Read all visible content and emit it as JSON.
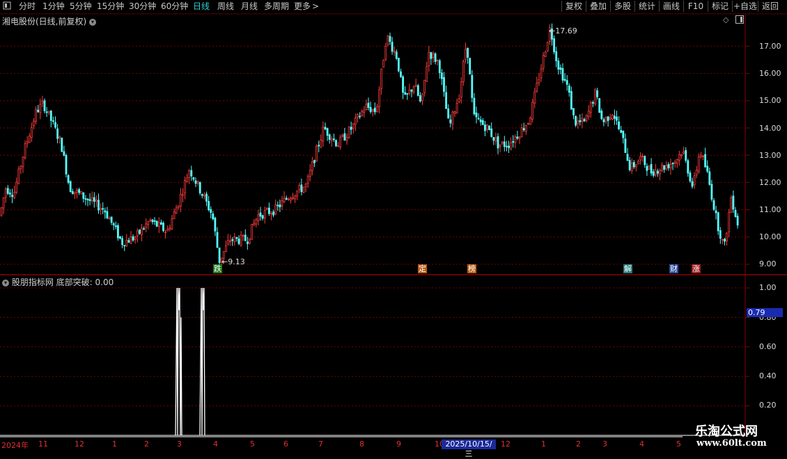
{
  "toolbar": {
    "periods": [
      "分时",
      "1分钟",
      "5分钟",
      "15分钟",
      "30分钟",
      "60分钟",
      "日线",
      "周线",
      "月线",
      "多周期",
      "更多"
    ],
    "active_period": "日线",
    "more_arrow": ">",
    "buttons": [
      "复权",
      "叠加",
      "多股",
      "统计",
      "画线",
      "F10",
      "标记",
      "+自选",
      "返回"
    ]
  },
  "chart_title": "湘电股份(日线,前复权)",
  "indicator_title": "股朋指标网  底部突破: 0.00",
  "price_axis": [
    "17.00",
    "16.00",
    "15.00",
    "14.00",
    "13.00",
    "12.00",
    "11.00",
    "10.00",
    "9.00"
  ],
  "indicator_axis": [
    "1.00",
    "0.80",
    "0.60",
    "0.40",
    "0.20"
  ],
  "indicator_current_value": "0.79",
  "high_label": "17.69",
  "low_label": "9.13",
  "event_markers": [
    {
      "id": "die",
      "text": "跌",
      "color": "#1a7a1a"
    },
    {
      "id": "ding",
      "text": "定",
      "color": "#b85a10"
    },
    {
      "id": "bang",
      "text": "榜",
      "color": "#b85a10"
    },
    {
      "id": "jie",
      "text": "解",
      "color": "#207a7a"
    },
    {
      "id": "cai",
      "text": "财",
      "color": "#2a4a9a"
    },
    {
      "id": "zhang",
      "text": "涨",
      "color": "#9a1a1a"
    }
  ],
  "time_axis": [
    "2024年",
    "11",
    "12",
    "1",
    "2",
    "3",
    "4",
    "5",
    "6",
    "7",
    "8",
    "9",
    "10",
    "12",
    "1",
    "2",
    "3",
    "4",
    "5"
  ],
  "cursor_date": "2025/10/15/三",
  "watermark": {
    "title": "乐淘公式网",
    "url": "www.60lt.com"
  },
  "colors": {
    "up": "#ff3b3b",
    "down": "#54ffff",
    "grid": "#7a0000",
    "axis": "#8b0000",
    "indicator": "#ffffff"
  },
  "chart_data": {
    "type": "line",
    "ylim": [
      9.0,
      17.69
    ],
    "keypoints": [
      [
        0,
        10.8
      ],
      [
        8,
        11.8
      ],
      [
        20,
        11.6
      ],
      [
        35,
        13.2
      ],
      [
        52,
        14.6
      ],
      [
        62,
        14.9
      ],
      [
        75,
        14.2
      ],
      [
        88,
        13.4
      ],
      [
        100,
        11.8
      ],
      [
        125,
        11.4
      ],
      [
        150,
        11.0
      ],
      [
        165,
        10.3
      ],
      [
        175,
        9.8
      ],
      [
        195,
        10.0
      ],
      [
        215,
        10.6
      ],
      [
        240,
        10.2
      ],
      [
        258,
        11.4
      ],
      [
        272,
        12.5
      ],
      [
        290,
        11.6
      ],
      [
        305,
        10.8
      ],
      [
        315,
        9.13
      ],
      [
        330,
        9.9
      ],
      [
        355,
        9.9
      ],
      [
        370,
        10.8
      ],
      [
        395,
        11.0
      ],
      [
        415,
        11.5
      ],
      [
        440,
        11.9
      ],
      [
        455,
        13.2
      ],
      [
        465,
        14.0
      ],
      [
        485,
        13.4
      ],
      [
        505,
        14.0
      ],
      [
        525,
        14.8
      ],
      [
        540,
        14.6
      ],
      [
        555,
        17.4
      ],
      [
        570,
        16.6
      ],
      [
        580,
        15.0
      ],
      [
        595,
        15.6
      ],
      [
        605,
        14.8
      ],
      [
        615,
        16.8
      ],
      [
        630,
        16.4
      ],
      [
        645,
        14.0
      ],
      [
        660,
        15.3
      ],
      [
        670,
        17.2
      ],
      [
        680,
        14.4
      ],
      [
        700,
        14.0
      ],
      [
        715,
        13.4
      ],
      [
        730,
        13.4
      ],
      [
        745,
        13.8
      ],
      [
        760,
        14.3
      ],
      [
        775,
        16.0
      ],
      [
        790,
        17.69
      ],
      [
        800,
        16.4
      ],
      [
        815,
        15.5
      ],
      [
        825,
        14.2
      ],
      [
        840,
        14.2
      ],
      [
        855,
        15.3
      ],
      [
        865,
        14.2
      ],
      [
        880,
        14.6
      ],
      [
        895,
        13.5
      ],
      [
        905,
        12.5
      ],
      [
        920,
        12.9
      ],
      [
        935,
        12.4
      ],
      [
        955,
        12.6
      ],
      [
        970,
        12.8
      ],
      [
        980,
        13.2
      ],
      [
        995,
        11.8
      ],
      [
        1005,
        13.2
      ],
      [
        1015,
        12.4
      ],
      [
        1030,
        10.5
      ],
      [
        1040,
        9.6
      ],
      [
        1050,
        11.5
      ],
      [
        1062,
        10.2
      ]
    ],
    "indicator_spikes": [
      {
        "x": 252,
        "w": 14,
        "value": 1.0
      },
      {
        "x": 287,
        "w": 10,
        "value": 1.0
      }
    ]
  }
}
